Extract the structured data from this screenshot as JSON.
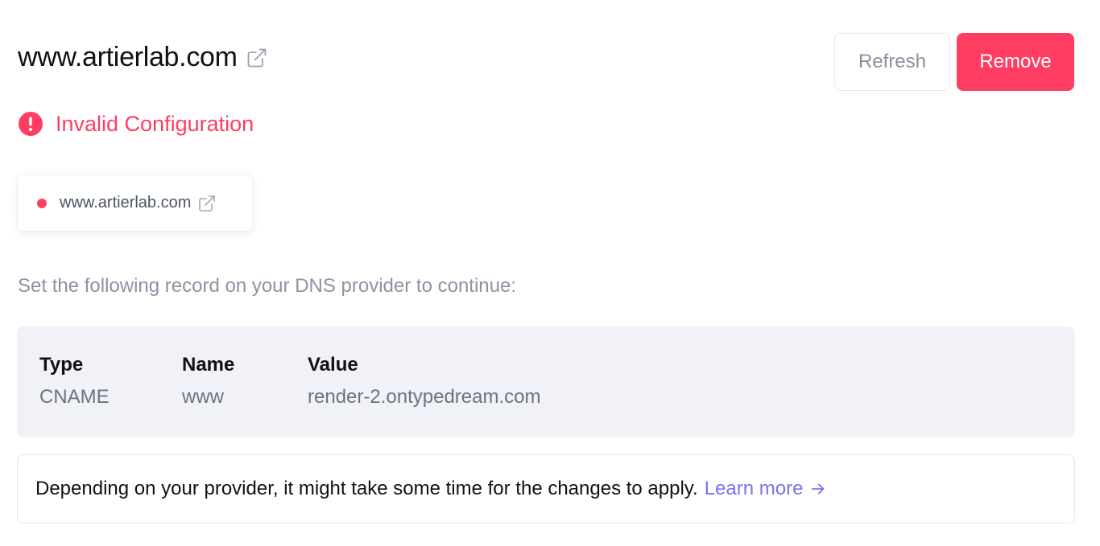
{
  "header": {
    "domain": "www.artierlab.com",
    "external_link_icon": "external-link-icon",
    "refresh_label": "Refresh",
    "remove_label": "Remove"
  },
  "status": {
    "icon": "exclamation-circle-icon",
    "text": "Invalid Configuration",
    "color": "#ff3d62"
  },
  "chip": {
    "domain": "www.artierlab.com",
    "status_dot_color": "#ff3d62",
    "external_link_icon": "external-link-icon"
  },
  "instruction": "Set the following record on your DNS provider to continue:",
  "record": {
    "headers": {
      "type": "Type",
      "name": "Name",
      "value": "Value"
    },
    "values": {
      "type": "CNAME",
      "name": "www",
      "value": "render-2.ontypedream.com"
    }
  },
  "note": {
    "text": "Depending on your provider, it might take some time for the changes to apply.",
    "link_label": "Learn more",
    "link_icon": "arrow-right-icon"
  },
  "colors": {
    "accent": "#ff3d62",
    "link": "#7b72f0",
    "muted": "#8c93a1",
    "record_bg": "#f1f2f7"
  }
}
